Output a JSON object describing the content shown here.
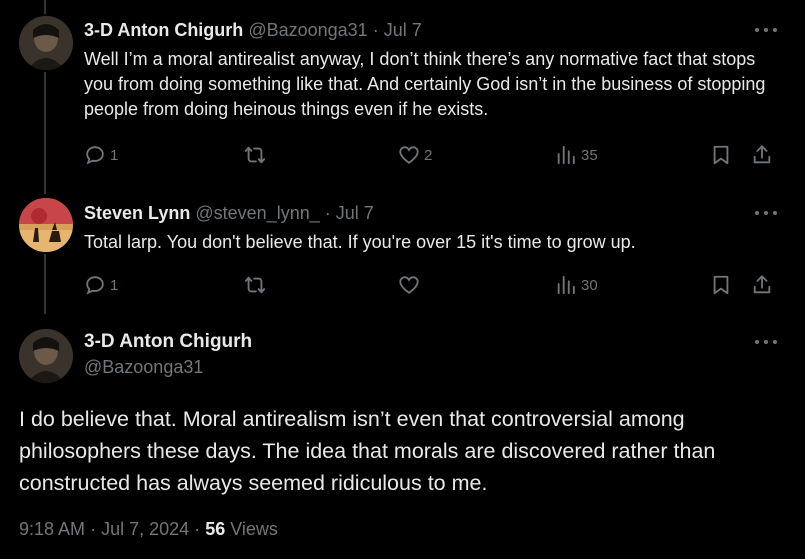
{
  "tweet1": {
    "name": "3-D Anton Chigurh",
    "handle": "@Bazoonga31",
    "dot": "·",
    "date": "Jul 7",
    "text": "Well I’m a moral antirealist anyway, I don’t think there’s any normative fact that stops you from doing something like that. And certainly God isn’t in the business of stopping people from doing heinous things even if he exists.",
    "replies": "1",
    "retweets": "",
    "likes": "2",
    "views": "35"
  },
  "tweet2": {
    "name": "Steven Lynn",
    "handle": "@steven_lynn_",
    "dot": "·",
    "date": "Jul 7",
    "text": "Total larp. You don't believe that. If you're over 15 it's time to grow up.",
    "replies": "1",
    "retweets": "",
    "likes": "",
    "views": "30"
  },
  "main_tweet": {
    "name": "3-D Anton Chigurh",
    "handle": "@Bazoonga31",
    "text": "I do believe that. Moral antirealism isn’t even that controversial among philosophers these days. The idea that morals are discovered rather than constructed has always seemed ridiculous to me.",
    "time": "9:18 AM",
    "dot1": "·",
    "date": "Jul 7, 2024",
    "dot2": "·",
    "views_count": "56",
    "views_label": "Views"
  },
  "icons": {
    "reply": "reply-icon",
    "retweet": "retweet-icon",
    "like": "heart-icon",
    "views": "views-icon",
    "bookmark": "bookmark-icon",
    "share": "share-icon",
    "more": "more-icon"
  },
  "colors": {
    "background": "#000000",
    "text": "#e7e9ea",
    "muted": "#71767b",
    "thread_line": "#333639"
  }
}
